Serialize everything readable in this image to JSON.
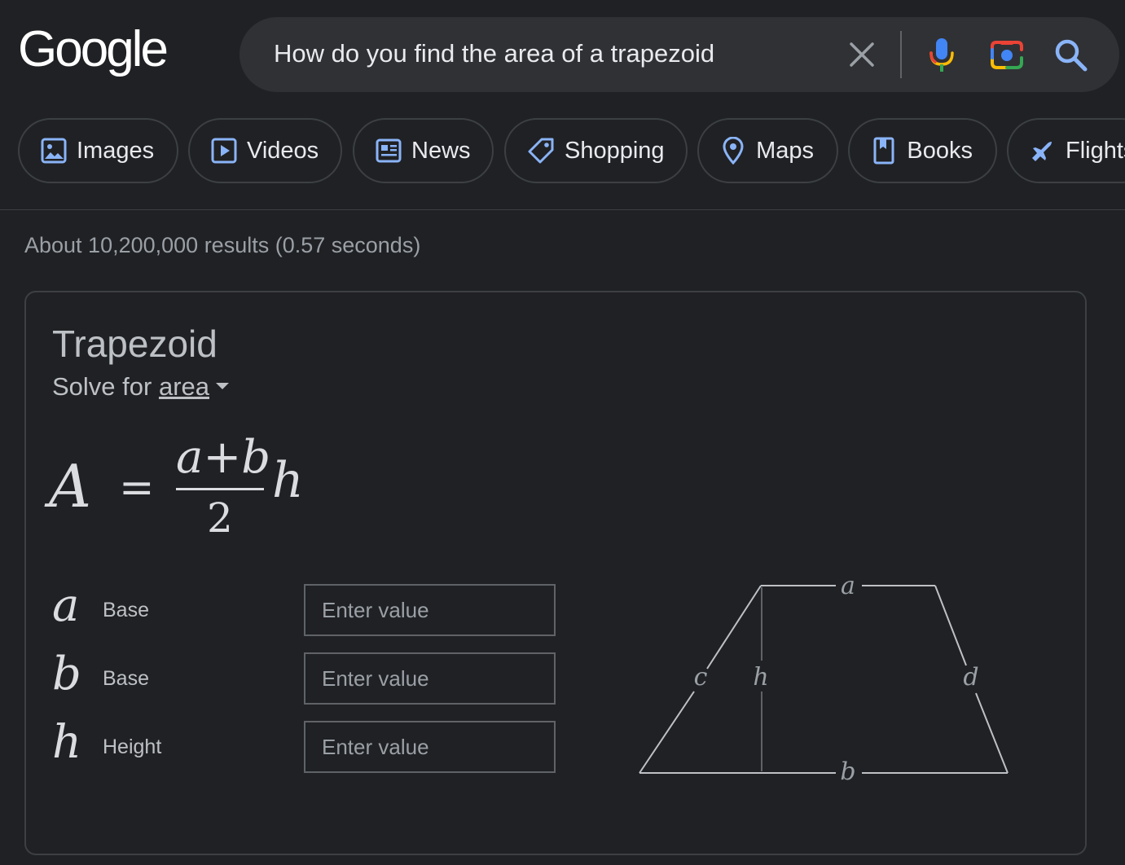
{
  "logo": {
    "text": "Google"
  },
  "search": {
    "query": "How do you find the area of a trapezoid"
  },
  "chips": [
    {
      "label": "Images",
      "icon": "image-icon"
    },
    {
      "label": "Videos",
      "icon": "video-icon"
    },
    {
      "label": "News",
      "icon": "news-icon"
    },
    {
      "label": "Shopping",
      "icon": "tag-icon"
    },
    {
      "label": "Maps",
      "icon": "map-pin-icon"
    },
    {
      "label": "Books",
      "icon": "book-icon"
    },
    {
      "label": "Flights",
      "icon": "plane-icon"
    }
  ],
  "result_stats": "About 10,200,000 results (0.57 seconds)",
  "calculator": {
    "title": "Trapezoid",
    "solve_for_prefix": "Solve for",
    "solve_for_value": "area",
    "formula": {
      "lhs": "A",
      "equals": "=",
      "numerator": "a+b",
      "denominator": "2",
      "rhs": "h"
    },
    "variables": [
      {
        "symbol": "a",
        "label": "Base",
        "placeholder": "Enter value"
      },
      {
        "symbol": "b",
        "label": "Base",
        "placeholder": "Enter value"
      },
      {
        "symbol": "h",
        "label": "Height",
        "placeholder": "Enter value"
      }
    ],
    "diagram_labels": {
      "top": "a",
      "bottom": "b",
      "left": "c",
      "right": "d",
      "height": "h"
    }
  },
  "colors": {
    "background": "#202124",
    "search_bg": "#303134",
    "border": "#3c4043",
    "chip_icon": "#8ab4f8",
    "text_secondary": "#9aa0a6"
  }
}
